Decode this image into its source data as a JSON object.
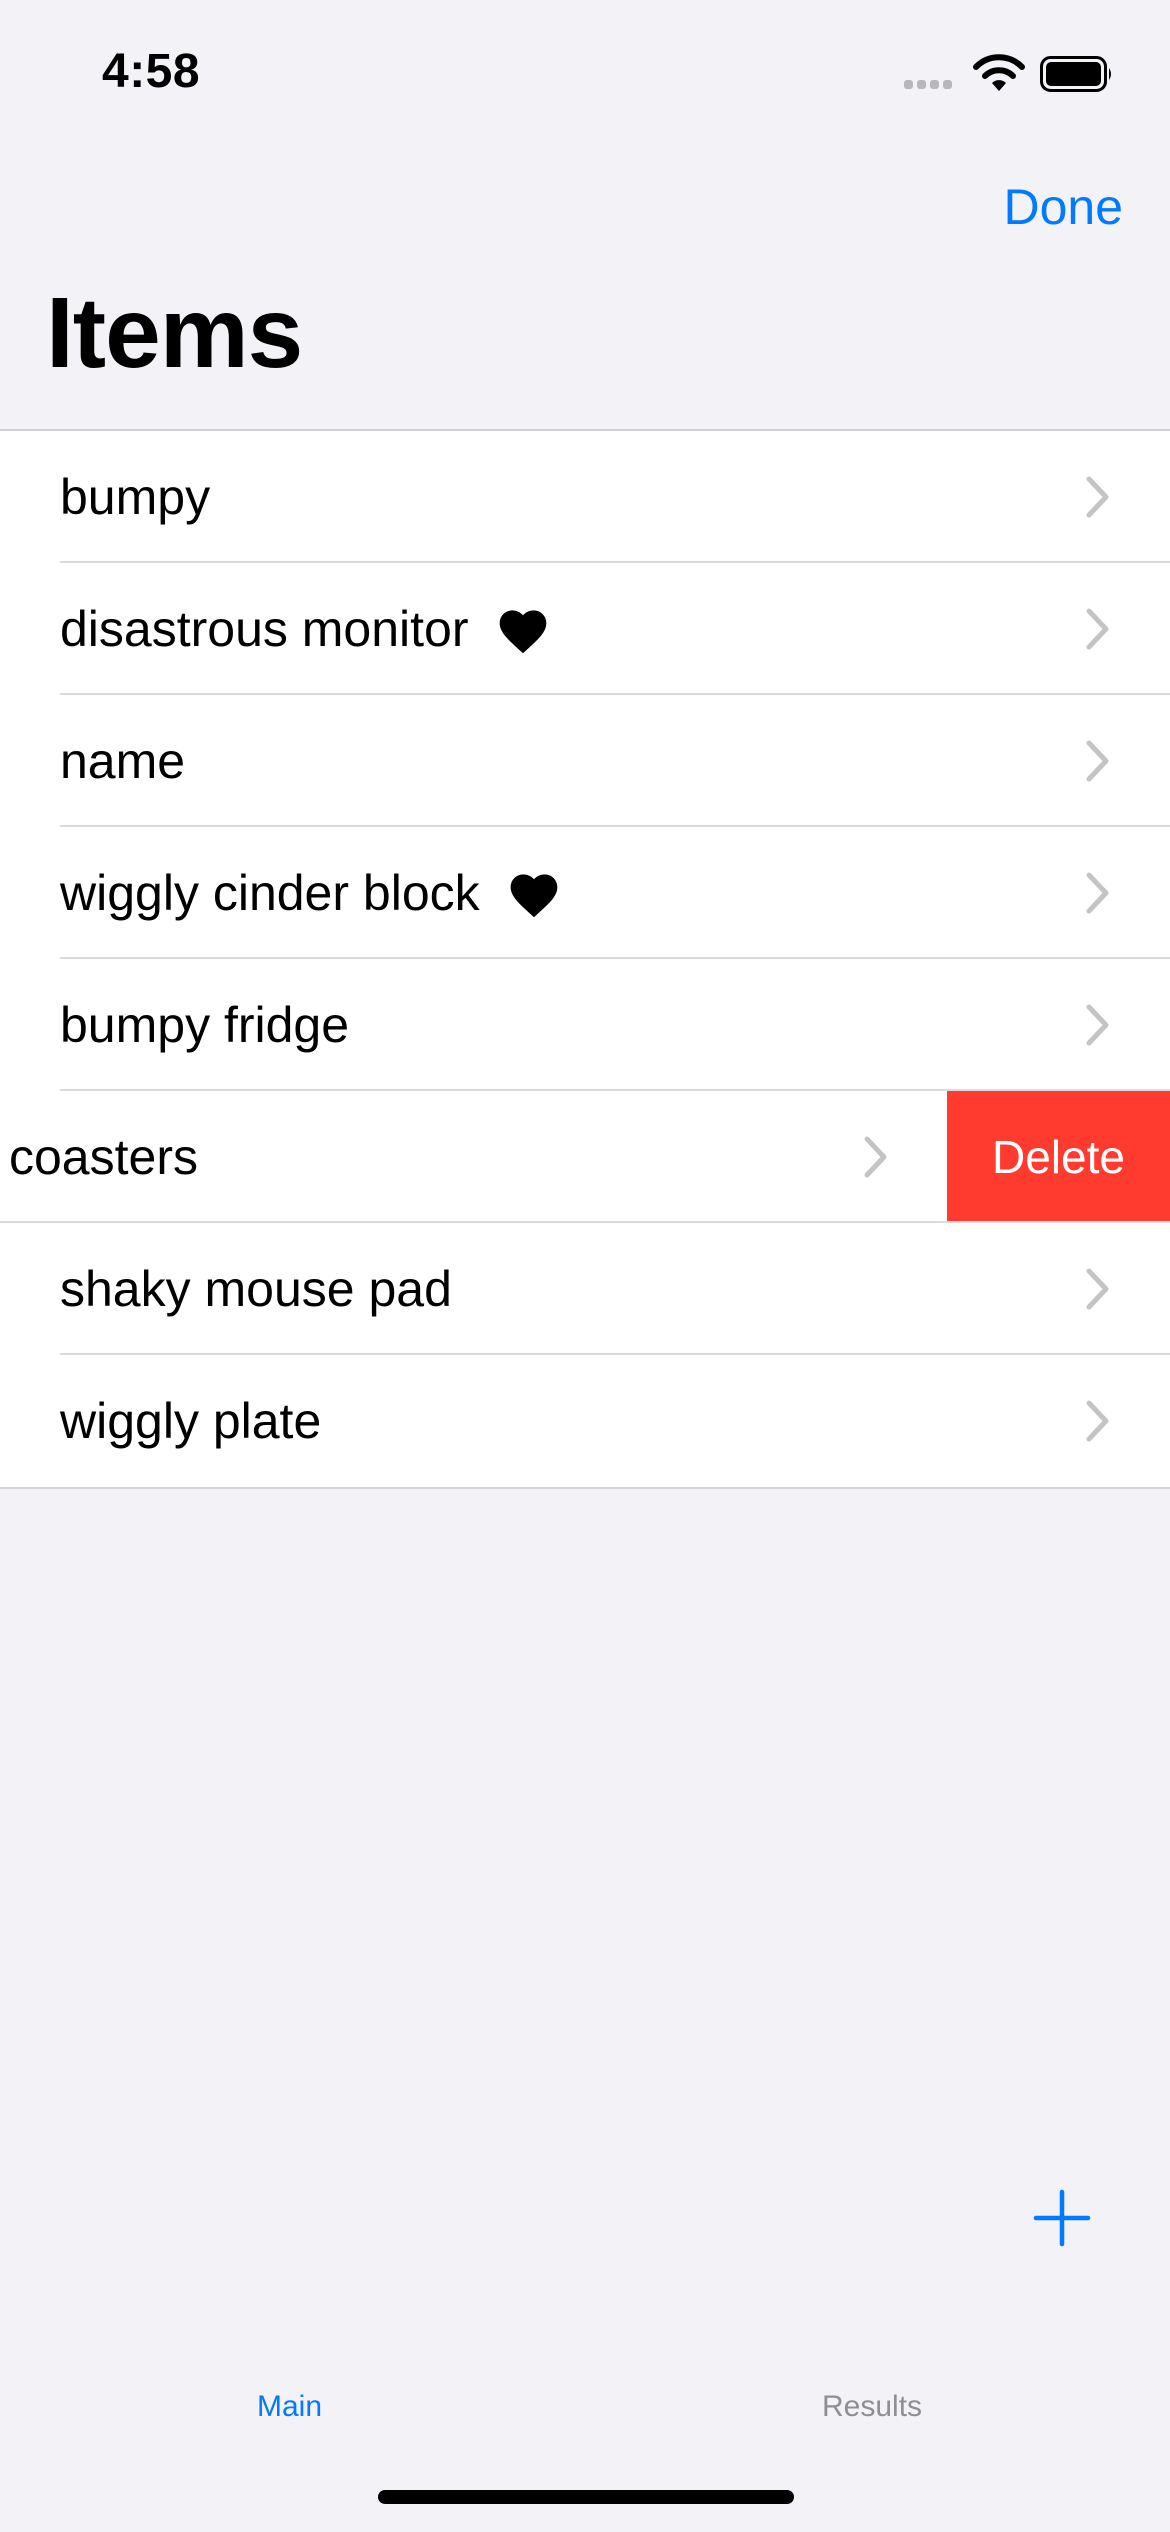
{
  "status_bar": {
    "time": "4:58"
  },
  "nav": {
    "done_label": "Done",
    "title": "Items"
  },
  "items": [
    {
      "label": "bumpy",
      "favorite": false
    },
    {
      "label": "disastrous monitor",
      "favorite": true
    },
    {
      "label": "name",
      "favorite": false
    },
    {
      "label": "wiggly cinder block",
      "favorite": true
    },
    {
      "label": "bumpy fridge",
      "favorite": false
    },
    {
      "label": "coasters",
      "favorite": false,
      "delete_label": "Delete"
    },
    {
      "label": "shaky mouse pad",
      "favorite": false
    },
    {
      "label": "wiggly plate",
      "favorite": false
    }
  ],
  "tabs": [
    {
      "label": "Main",
      "selected": true
    },
    {
      "label": "Results",
      "selected": false
    }
  ],
  "colors": {
    "accent": "#007aff",
    "destructive": "#ff3b30",
    "background": "#f2f2f7"
  },
  "icons": [
    "heart-icon",
    "chevron-right-icon",
    "plus-icon",
    "wifi-icon",
    "battery-icon"
  ]
}
